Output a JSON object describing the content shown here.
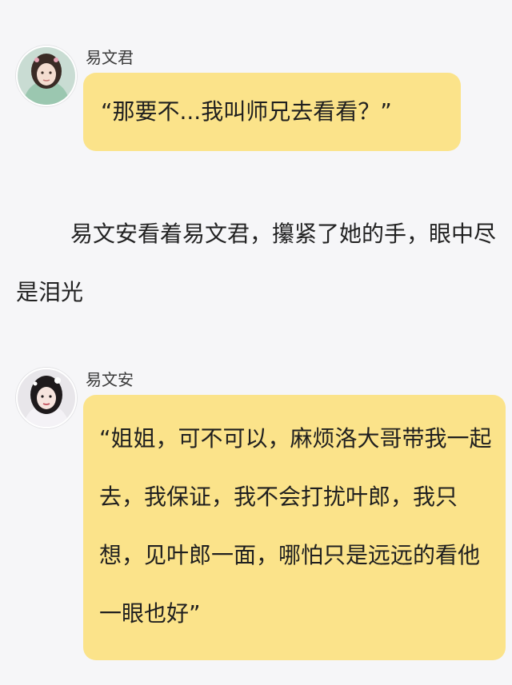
{
  "messages": [
    {
      "sender": "易文君",
      "text": "“那要不...我叫师兄去看看？”",
      "avatar_icon": "girl-portrait-icon"
    },
    {
      "sender": "易文安",
      "text": "“姐姐，可不可以，麻烦洛大哥带我一起去，我保证，我不会打扰叶郎，我只想，见叶郎一面，哪怕只是远远的看他一眼也好”",
      "avatar_icon": "girl-portrait-icon"
    }
  ],
  "narration": "易文安看着易文君，攥紧了她的手，眼中尽是泪光",
  "colors": {
    "background": "#f6f6f8",
    "bubble": "#fbe38a",
    "text": "#222222"
  }
}
